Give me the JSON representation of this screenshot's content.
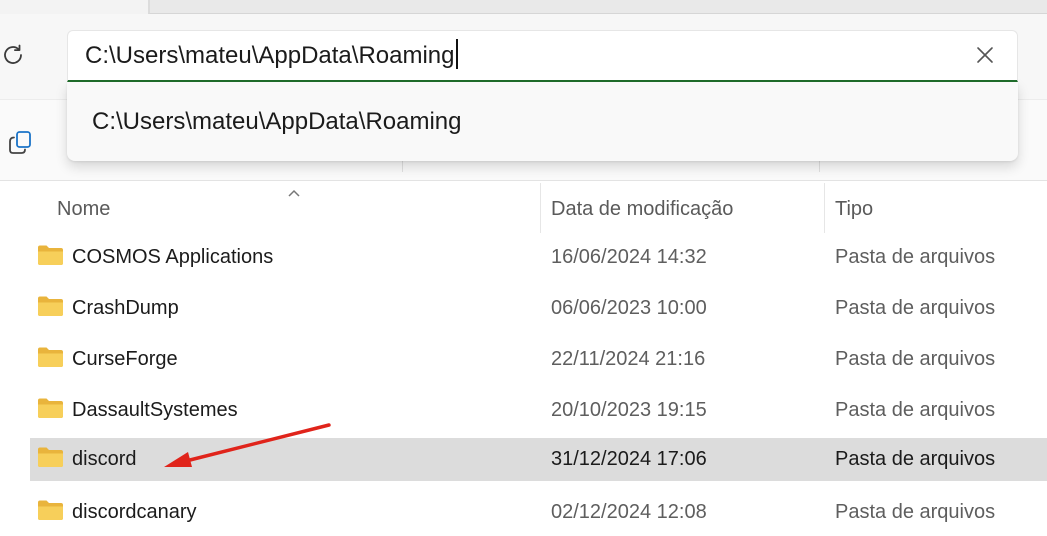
{
  "address_bar": {
    "value": "C:\\Users\\mateu\\AppData\\Roaming",
    "suggestion": "C:\\Users\\mateu\\AppData\\Roaming"
  },
  "columns": {
    "name": "Nome",
    "date": "Data de modificação",
    "type": "Tipo"
  },
  "files": [
    {
      "name": "COSMOS Applications",
      "date": "16/06/2024 14:32",
      "type": "Pasta de arquivos"
    },
    {
      "name": "CrashDump",
      "date": "06/06/2023 10:00",
      "type": "Pasta de arquivos"
    },
    {
      "name": "CurseForge",
      "date": "22/11/2024 21:16",
      "type": "Pasta de arquivos"
    },
    {
      "name": "DassaultSystemes",
      "date": "20/10/2023 19:15",
      "type": "Pasta de arquivos"
    },
    {
      "name": "discord",
      "date": "31/12/2024 17:06",
      "type": "Pasta de arquivos",
      "selected": true
    },
    {
      "name": "discordcanary",
      "date": "02/12/2024 12:08",
      "type": "Pasta de arquivos"
    }
  ],
  "icons": {
    "refresh": "refresh-icon",
    "copy": "copy-icon",
    "clear": "close-icon",
    "folder": "folder-icon",
    "annotation": "red-arrow"
  },
  "colors": {
    "accent_underline": "#1e6b2a",
    "selected_row": "#dcdcdc",
    "folder": "#f4c54a",
    "arrow": "#e0241b"
  }
}
